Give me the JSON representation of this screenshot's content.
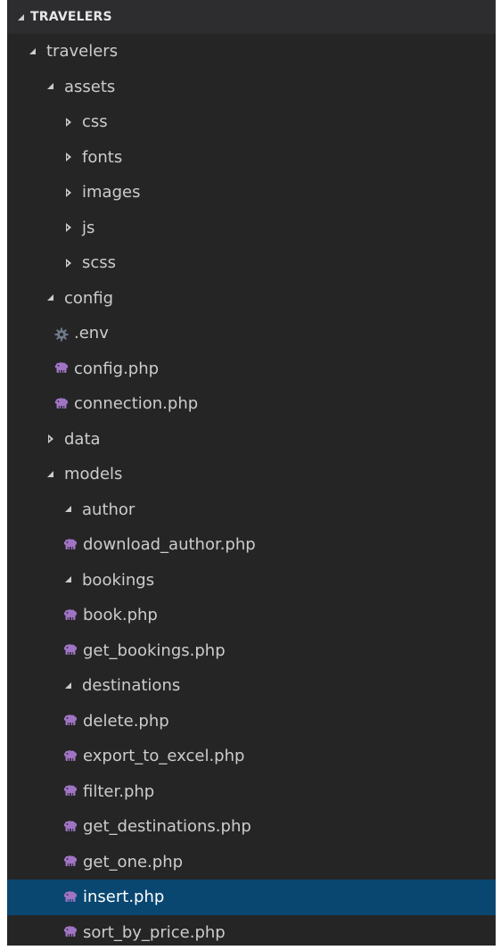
{
  "explorer": {
    "section_title": "TRAVELERS",
    "colors": {
      "background": "#252526",
      "header_background": "#2d2d30",
      "selected_background": "#094771",
      "php_icon": "#a074c4",
      "gear_icon": "#6d7a8a",
      "text": "#cccccc"
    },
    "items": [
      {
        "label": "travelers",
        "kind": "folder",
        "state": "expanded",
        "depth": 0
      },
      {
        "label": "assets",
        "kind": "folder",
        "state": "expanded",
        "depth": 1
      },
      {
        "label": "css",
        "kind": "folder",
        "state": "collapsed",
        "depth": 2
      },
      {
        "label": "fonts",
        "kind": "folder",
        "state": "collapsed",
        "depth": 2
      },
      {
        "label": "images",
        "kind": "folder",
        "state": "collapsed",
        "depth": 2
      },
      {
        "label": "js",
        "kind": "folder",
        "state": "collapsed",
        "depth": 2
      },
      {
        "label": "scss",
        "kind": "folder",
        "state": "collapsed",
        "depth": 2
      },
      {
        "label": "config",
        "kind": "folder",
        "state": "expanded",
        "depth": 1
      },
      {
        "label": ".env",
        "kind": "file",
        "icon": "gear-icon",
        "depth": 1
      },
      {
        "label": "config.php",
        "kind": "file",
        "icon": "php-elephant-icon",
        "depth": 1
      },
      {
        "label": "connection.php",
        "kind": "file",
        "icon": "php-elephant-icon",
        "depth": 1
      },
      {
        "label": "data",
        "kind": "folder",
        "state": "collapsed",
        "depth": 1
      },
      {
        "label": "models",
        "kind": "folder",
        "state": "expanded",
        "depth": 1
      },
      {
        "label": "author",
        "kind": "folder",
        "state": "expanded",
        "depth": 2
      },
      {
        "label": "download_author.php",
        "kind": "file",
        "icon": "php-elephant-icon",
        "depth": 2
      },
      {
        "label": "bookings",
        "kind": "folder",
        "state": "expanded",
        "depth": 2
      },
      {
        "label": "book.php",
        "kind": "file",
        "icon": "php-elephant-icon",
        "depth": 2
      },
      {
        "label": "get_bookings.php",
        "kind": "file",
        "icon": "php-elephant-icon",
        "depth": 2
      },
      {
        "label": "destinations",
        "kind": "folder",
        "state": "expanded",
        "depth": 2
      },
      {
        "label": "delete.php",
        "kind": "file",
        "icon": "php-elephant-icon",
        "depth": 2
      },
      {
        "label": "export_to_excel.php",
        "kind": "file",
        "icon": "php-elephant-icon",
        "depth": 2
      },
      {
        "label": "filter.php",
        "kind": "file",
        "icon": "php-elephant-icon",
        "depth": 2
      },
      {
        "label": "get_destinations.php",
        "kind": "file",
        "icon": "php-elephant-icon",
        "depth": 2
      },
      {
        "label": "get_one.php",
        "kind": "file",
        "icon": "php-elephant-icon",
        "depth": 2
      },
      {
        "label": "insert.php",
        "kind": "file",
        "icon": "php-elephant-icon",
        "depth": 2,
        "selected": true
      },
      {
        "label": "sort_by_price.php",
        "kind": "file",
        "icon": "php-elephant-icon",
        "depth": 2
      }
    ]
  }
}
